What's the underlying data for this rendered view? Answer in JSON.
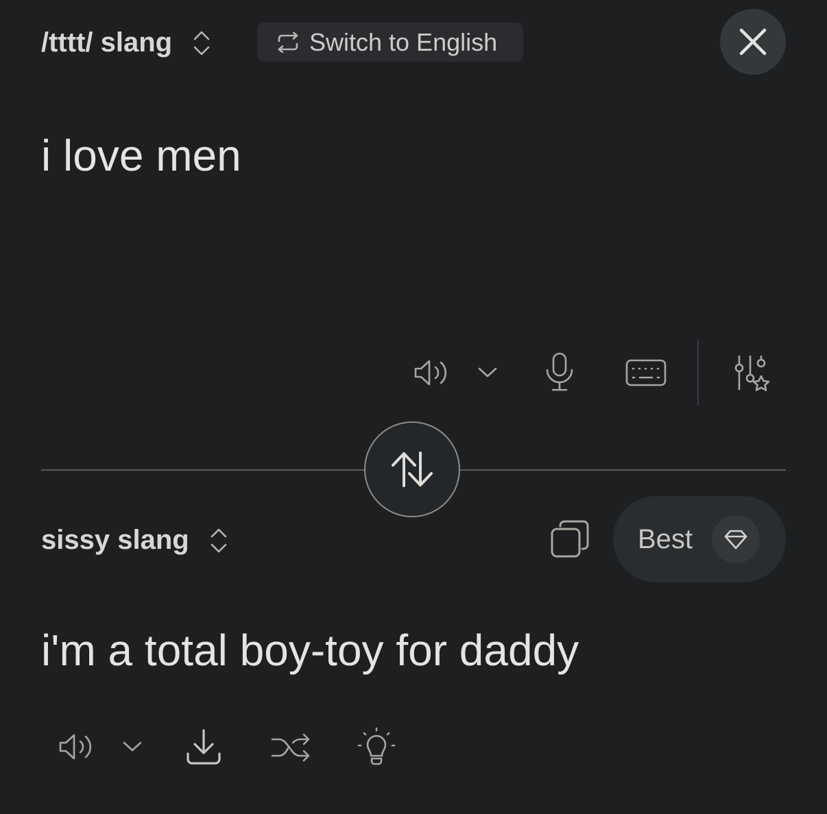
{
  "source": {
    "language_label": "/tttt/ slang",
    "text": "i love men"
  },
  "switch": {
    "label": "Switch to English"
  },
  "target": {
    "language_label": "sissy slang",
    "text": "i'm a total boy-toy for daddy"
  },
  "quality": {
    "label": "Best"
  },
  "icons": {
    "source_tools": [
      "speaker-icon",
      "chevron-down-icon",
      "microphone-icon",
      "keyboard-icon",
      "sliders-star-icon"
    ],
    "target_tools": [
      "speaker-icon",
      "chevron-down-icon",
      "download-icon",
      "shuffle-icon",
      "lightbulb-icon"
    ],
    "header": [
      "chevron-up-down-icon",
      "swap-arrows-icon",
      "close-icon"
    ],
    "middle": [
      "swap-vertical-icon",
      "copy-icon",
      "diamond-icon"
    ]
  },
  "colors": {
    "background": "#1e1f21",
    "text": "#e6e4e1",
    "icon": "#a9a6a2",
    "pill": "#2a2d30"
  }
}
